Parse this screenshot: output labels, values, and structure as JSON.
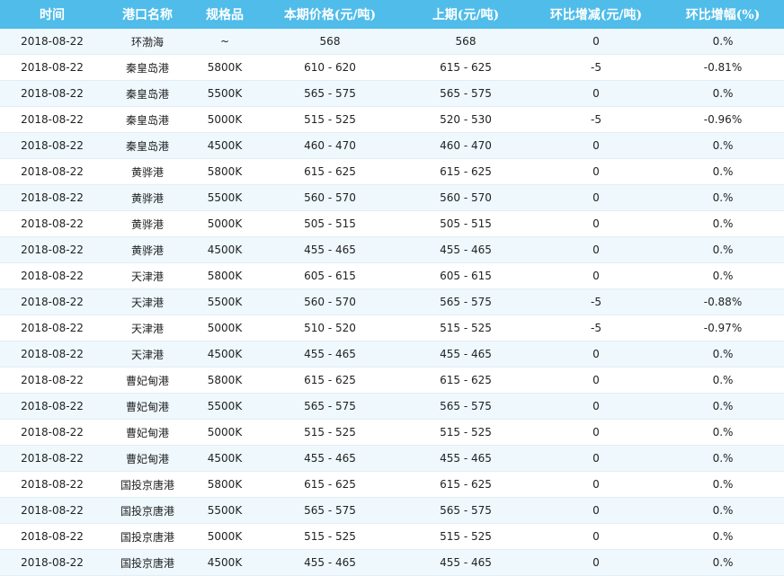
{
  "table": {
    "headers": [
      "时间",
      "港口名称",
      "规格品",
      "本期价格(元/吨)",
      "上期(元/吨)",
      "环比增减(元/吨)",
      "环比增幅(%)"
    ],
    "rows": [
      [
        "2018-08-22",
        "环渤海",
        "~",
        "568",
        "568",
        "0",
        "0.%"
      ],
      [
        "2018-08-22",
        "秦皇岛港",
        "5800K",
        "610 - 620",
        "615 - 625",
        "-5",
        "-0.81%"
      ],
      [
        "2018-08-22",
        "秦皇岛港",
        "5500K",
        "565 - 575",
        "565 - 575",
        "0",
        "0.%"
      ],
      [
        "2018-08-22",
        "秦皇岛港",
        "5000K",
        "515 - 525",
        "520 - 530",
        "-5",
        "-0.96%"
      ],
      [
        "2018-08-22",
        "秦皇岛港",
        "4500K",
        "460 - 470",
        "460 - 470",
        "0",
        "0.%"
      ],
      [
        "2018-08-22",
        "黄骅港",
        "5800K",
        "615 - 625",
        "615 - 625",
        "0",
        "0.%"
      ],
      [
        "2018-08-22",
        "黄骅港",
        "5500K",
        "560 - 570",
        "560 - 570",
        "0",
        "0.%"
      ],
      [
        "2018-08-22",
        "黄骅港",
        "5000K",
        "505 - 515",
        "505 - 515",
        "0",
        "0.%"
      ],
      [
        "2018-08-22",
        "黄骅港",
        "4500K",
        "455 - 465",
        "455 - 465",
        "0",
        "0.%"
      ],
      [
        "2018-08-22",
        "天津港",
        "5800K",
        "605 - 615",
        "605 - 615",
        "0",
        "0.%"
      ],
      [
        "2018-08-22",
        "天津港",
        "5500K",
        "560 - 570",
        "565 - 575",
        "-5",
        "-0.88%"
      ],
      [
        "2018-08-22",
        "天津港",
        "5000K",
        "510 - 520",
        "515 - 525",
        "-5",
        "-0.97%"
      ],
      [
        "2018-08-22",
        "天津港",
        "4500K",
        "455 - 465",
        "455 - 465",
        "0",
        "0.%"
      ],
      [
        "2018-08-22",
        "曹妃甸港",
        "5800K",
        "615 - 625",
        "615 - 625",
        "0",
        "0.%"
      ],
      [
        "2018-08-22",
        "曹妃甸港",
        "5500K",
        "565 - 575",
        "565 - 575",
        "0",
        "0.%"
      ],
      [
        "2018-08-22",
        "曹妃甸港",
        "5000K",
        "515 - 525",
        "515 - 525",
        "0",
        "0.%"
      ],
      [
        "2018-08-22",
        "曹妃甸港",
        "4500K",
        "455 - 465",
        "455 - 465",
        "0",
        "0.%"
      ],
      [
        "2018-08-22",
        "国投京唐港",
        "5800K",
        "615 - 625",
        "615 - 625",
        "0",
        "0.%"
      ],
      [
        "2018-08-22",
        "国投京唐港",
        "5500K",
        "565 - 575",
        "565 - 575",
        "0",
        "0.%"
      ],
      [
        "2018-08-22",
        "国投京唐港",
        "5000K",
        "515 - 525",
        "515 - 525",
        "0",
        "0.%"
      ],
      [
        "2018-08-22",
        "国投京唐港",
        "4500K",
        "455 - 465",
        "455 - 465",
        "0",
        "0.%"
      ]
    ]
  }
}
